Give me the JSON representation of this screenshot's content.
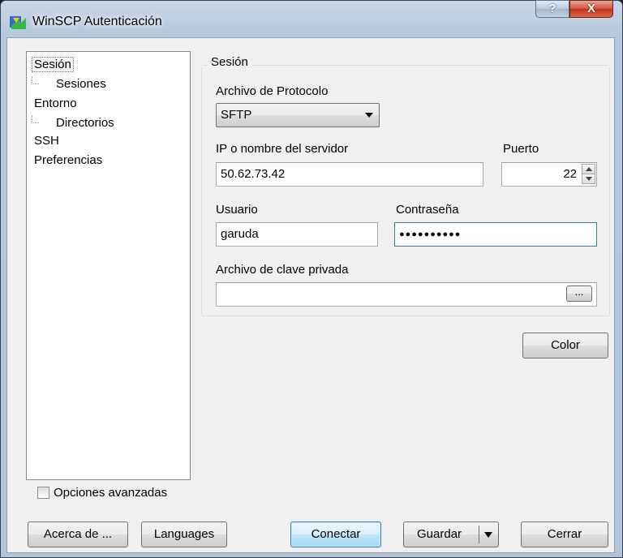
{
  "window": {
    "title": "WinSCP Autenticación",
    "help_label": "?",
    "close_label": "X"
  },
  "tree": {
    "items": [
      {
        "label": "Sesión",
        "selected": true,
        "level": 0
      },
      {
        "label": "Sesiones",
        "level": 1
      },
      {
        "label": "Entorno",
        "level": 0
      },
      {
        "label": "Directorios",
        "level": 1
      },
      {
        "label": "SSH",
        "level": 0
      },
      {
        "label": "Preferencias",
        "level": 0
      }
    ]
  },
  "session": {
    "group_label": "Sesión",
    "protocol": {
      "label": "Archivo de Protocolo",
      "value": "SFTP"
    },
    "host": {
      "label": "IP o nombre del servidor",
      "value": "50.62.73.42"
    },
    "port": {
      "label": "Puerto",
      "value": "22"
    },
    "user": {
      "label": "Usuario",
      "value": "garuda"
    },
    "password": {
      "label": "Contraseña",
      "value": "●●●●●●●●●●"
    },
    "private_key": {
      "label": "Archivo de clave privada",
      "value": "",
      "browse_label": "..."
    }
  },
  "buttons": {
    "color": "Color",
    "about": "Acerca de ...",
    "languages": "Languages",
    "connect": "Conectar",
    "save": "Guardar",
    "close": "Cerrar"
  },
  "advanced": {
    "label": "Opciones avanzadas",
    "checked": false
  },
  "colors": {
    "frame": "#b7c8dc",
    "client": "#f0f0f0",
    "focus_border": "#3d7bad",
    "close_red": "#c2341b"
  }
}
